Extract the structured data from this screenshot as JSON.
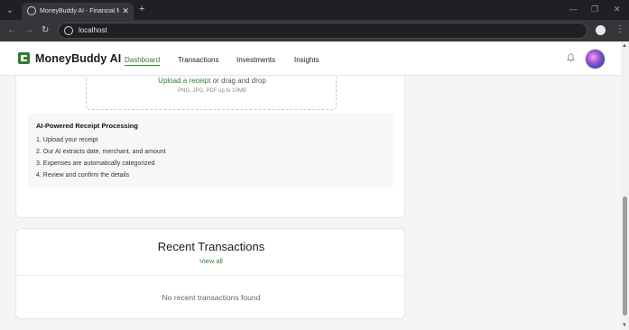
{
  "browser": {
    "tab_title": "MoneyBuddy AI - Financial Ma",
    "tab_close": "✕",
    "new_tab": "+",
    "url": "localhost",
    "menu_glyph": "⌄",
    "minimize": "—",
    "restore": "❐",
    "close": "✕",
    "back": "←",
    "forward": "→",
    "reload": "↻",
    "more": "⋮"
  },
  "header": {
    "brand": "MoneyBuddy AI",
    "nav": [
      {
        "label": "Dashboard",
        "active": true
      },
      {
        "label": "Transactions",
        "active": false
      },
      {
        "label": "Investments",
        "active": false
      },
      {
        "label": "Insights",
        "active": false
      }
    ]
  },
  "upload": {
    "link_text": "Upload a receipt",
    "rest_text": " or drag and drop",
    "hint": "PNG, JPG, PDF up to 10MB"
  },
  "processing": {
    "title": "AI-Powered Receipt Processing",
    "steps": [
      "1. Upload your receipt",
      "2. Our AI extracts date, merchant, and amount",
      "3. Expenses are automatically categorized",
      "4. Review and confirm the details"
    ]
  },
  "recent": {
    "title": "Recent Transactions",
    "view_all": "View all",
    "empty": "No recent transactions found"
  },
  "icons": {
    "logo": "wallet-logo-icon",
    "bell": "bell-icon",
    "upload": "upload-tray-icon"
  },
  "colors": {
    "accent": "#2e7d32",
    "chrome_dark": "#1f2023",
    "page_bg": "#f4f5f7"
  }
}
